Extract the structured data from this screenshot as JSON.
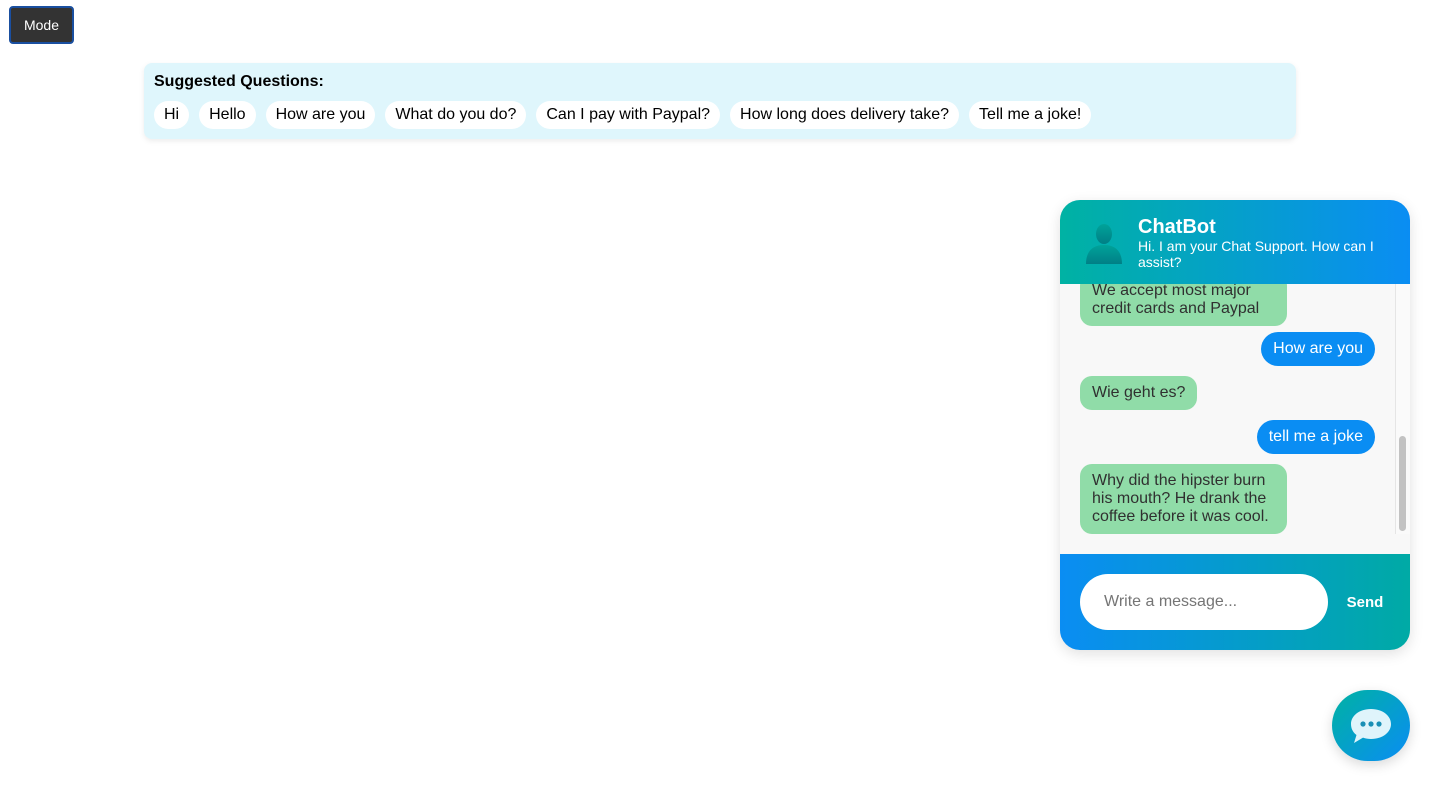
{
  "mode_button": {
    "label": "Mode"
  },
  "suggestions": {
    "title": "Suggested Questions:",
    "items": [
      "Hi",
      "Hello",
      "How are you",
      "What do you do?",
      "Can I pay with Paypal?",
      "How long does delivery take?",
      "Tell me a joke!"
    ]
  },
  "chat": {
    "header": {
      "name": "ChatBot",
      "subtitle": "Hi. I am your Chat Support. How can I assist?",
      "avatar_icon": "user-silhouette-icon"
    },
    "messages": [
      {
        "from": "bot",
        "text": "We accept most major credit cards and Paypal"
      },
      {
        "from": "user",
        "text": "How are you"
      },
      {
        "from": "bot",
        "text": "Wie geht es?"
      },
      {
        "from": "user",
        "text": "tell me a joke"
      },
      {
        "from": "bot",
        "text": "Why did the hipster burn his mouth? He drank the coffee before it was cool."
      }
    ],
    "input": {
      "placeholder": "Write a message...",
      "value": ""
    },
    "send_label": "Send",
    "colors": {
      "bot_bubble": "#90dca8",
      "user_bubble": "#0a8df3",
      "accent_teal": "#00b2a3",
      "accent_blue": "#0a8df3"
    }
  },
  "launcher": {
    "icon": "chat-bubble-icon"
  }
}
